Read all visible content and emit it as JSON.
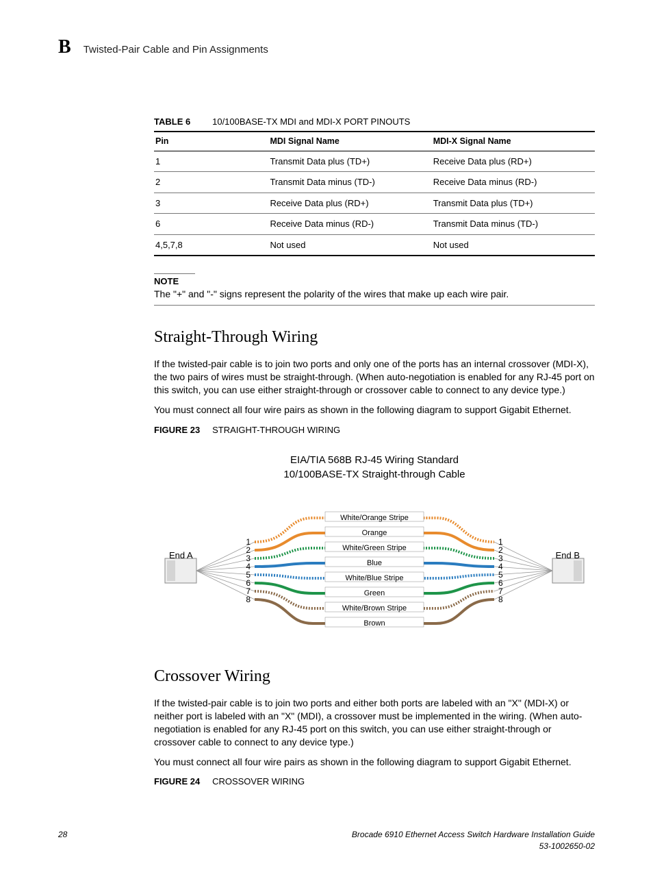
{
  "header": {
    "letter": "B",
    "title": "Twisted-Pair Cable and Pin Assignments"
  },
  "table": {
    "label": "TABLE 6",
    "caption": "10/100BASE-TX MDI and MDI-X PORT PINOUTS",
    "columns": {
      "c1": "Pin",
      "c2": "MDI Signal Name",
      "c3": "MDI-X Signal Name"
    },
    "rows": [
      {
        "c1": "1",
        "c2": "Transmit Data plus (TD+)",
        "c3": "Receive Data plus (RD+)"
      },
      {
        "c1": "2",
        "c2": "Transmit Data minus (TD-)",
        "c3": "Receive Data minus (RD-)"
      },
      {
        "c1": "3",
        "c2": "Receive Data plus (RD+)",
        "c3": "Transmit Data plus (TD+)"
      },
      {
        "c1": "6",
        "c2": "Receive Data minus (RD-)",
        "c3": "Transmit Data minus (TD-)"
      },
      {
        "c1": "4,5,7,8",
        "c2": "Not used",
        "c3": "Not used"
      }
    ]
  },
  "note": {
    "label": "NOTE",
    "text": "The \"+\" and \"-\" signs represent the polarity of the wires that make up each wire pair."
  },
  "section1": {
    "heading": "Straight-Through Wiring",
    "p1": "If the twisted-pair cable is to join two ports and only one of the ports has an internal crossover (MDI-X), the two pairs of wires must be straight-through. (When auto-negotiation is enabled for any RJ-45 port on this switch, you can use either straight-through or crossover cable to connect to any device type.)",
    "p2": "You must connect all four wire pairs as shown in the following diagram to support Gigabit Ethernet.",
    "figure_label": "FIGURE 23",
    "figure_caption": "STRAIGHT-THROUGH WIRING"
  },
  "diagram": {
    "title_line1": "EIA/TIA 568B RJ-45 Wiring Standard",
    "title_line2": "10/100BASE-TX Straight-through Cable",
    "end_a": "End A",
    "end_b": "End B",
    "wires": [
      {
        "label": "White/Orange Stripe",
        "stroke": "#e88b2d",
        "fill": "none",
        "dash": "2,2"
      },
      {
        "label": "Orange",
        "stroke": "#e88b2d",
        "fill": "none",
        "dash": ""
      },
      {
        "label": "White/Green Stripe",
        "stroke": "#1e9449",
        "fill": "none",
        "dash": "2,2"
      },
      {
        "label": "Blue",
        "stroke": "#2a7cbf",
        "fill": "none",
        "dash": ""
      },
      {
        "label": "White/Blue Stripe",
        "stroke": "#2a7cbf",
        "fill": "none",
        "dash": "2,2"
      },
      {
        "label": "Green",
        "stroke": "#1e9449",
        "fill": "none",
        "dash": ""
      },
      {
        "label": "White/Brown Stripe",
        "stroke": "#8a6a49",
        "fill": "none",
        "dash": "2,2"
      },
      {
        "label": "Brown",
        "stroke": "#8a6a49",
        "fill": "none",
        "dash": ""
      }
    ],
    "pins": [
      "1",
      "2",
      "3",
      "4",
      "5",
      "6",
      "7",
      "8"
    ]
  },
  "section2": {
    "heading": "Crossover Wiring",
    "p1": "If the twisted-pair cable is to join two ports and either both ports are labeled with an \"X\" (MDI-X) or neither port is labeled with an \"X\" (MDI), a crossover must be implemented in the wiring. (When auto-negotiation is enabled for any RJ-45 port on this switch, you can use either straight-through or crossover cable to connect to any device type.)",
    "p2": "You must connect all four wire pairs as shown in the following diagram to support Gigabit Ethernet.",
    "figure_label": "FIGURE 24",
    "figure_caption": "CROSSOVER WIRING"
  },
  "footer": {
    "page": "28",
    "doc_title": "Brocade 6910 Ethernet Access Switch Hardware Installation Guide",
    "doc_number": "53-1002650-02"
  }
}
